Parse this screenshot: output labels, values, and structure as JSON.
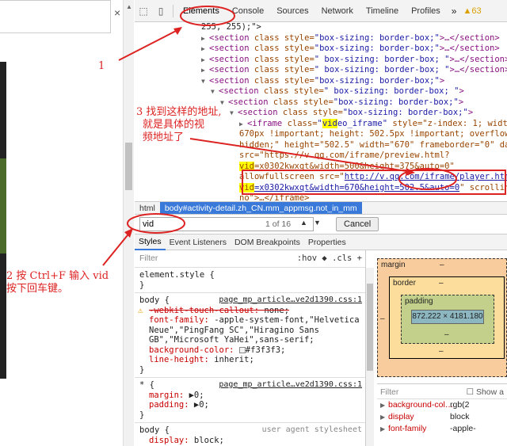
{
  "left": {
    "close_glyph": "×"
  },
  "tabs": {
    "items": [
      "Elements",
      "Console",
      "Sources",
      "Network",
      "Timeline",
      "Profiles"
    ],
    "more": "»",
    "warnings": "▲63"
  },
  "dom": {
    "lines": [
      {
        "indent": 7,
        "text": "255, 255);\">"
      },
      {
        "indent": 7,
        "tri": "▶",
        "tag": "<section",
        "attr": "class",
        "extra": " style=",
        "val": "\"box-sizing: border-box;\"",
        "tail": ">…</section>"
      },
      {
        "indent": 7,
        "tri": "▶",
        "tag": "<section",
        "attr": "class",
        "extra": " style=",
        "val": "\"box-sizing: border-box;\"",
        "tail": ">…</section>"
      },
      {
        "indent": 7,
        "tri": "▶",
        "tag": "<section",
        "attr": "class",
        "extra": " style=",
        "val": "\"   box-sizing: border-box; \"",
        "tail": ">…</section>"
      },
      {
        "indent": 7,
        "tri": "▶",
        "tag": "<section",
        "attr": "class",
        "extra": " style=",
        "val": "\"   box-sizing: border-box; \"",
        "tail": ">…</section>"
      },
      {
        "indent": 7,
        "tri": "▼",
        "tag": "<section",
        "attr": "class",
        "extra": " style=",
        "val": "\"box-sizing: border-box;\"",
        "tail": ">"
      },
      {
        "indent": 8,
        "tri": "▼",
        "tag": "<section",
        "attr": "class",
        "extra": " style=",
        "val": "\"   box-sizing: border-box; \"",
        "tail": ">"
      },
      {
        "indent": 9,
        "tri": "▼",
        "tag": "<section",
        "attr": "class",
        "extra": " style=",
        "val": "\"box-sizing: border-box;\"",
        "tail": ">"
      },
      {
        "indent": 10,
        "tri": "▼",
        "tag": "<section",
        "attr": "class",
        "extra": " style=",
        "val": "\"box-sizing: border-box;\"",
        "tail": ">"
      }
    ],
    "iframe_lines": [
      "670px !important; height: 502.5px !important; overflow:",
      "hidden;\" height=\"502.5\" width=\"670\" frameborder=\"0\" data-",
      "src=\"https://v.qq.com/iframe/preview.html?",
      "vid=x0302kwxqt&width=500&height=375&auto=0\"",
      "allowfullscreen src=\"http://v.qq.com/iframe/player.html?",
      "vid=x0302kwxqt&width=670&height=502.5&auto=0\" scrolling=\"",
      "no\">…</iframe>"
    ],
    "iframe_head_tag": "<iframe",
    "iframe_head_attr": " class=",
    "iframe_head_val_pre": "\"",
    "iframe_head_val_hl": "vid",
    "iframe_head_val_post": "eo_iframe\"",
    "iframe_head_tail": " style=\"z-index: 1; width:"
  },
  "breadcrumbs": {
    "html": "html",
    "body": "body#activity-detail.zh_CN.mm_appmsg.not_in_mm"
  },
  "search": {
    "value": "vid",
    "count": "1 of 16",
    "up": "▲",
    "down": "▼",
    "cancel": "Cancel"
  },
  "subtabs": [
    "Styles",
    "Event Listeners",
    "DOM Breakpoints",
    "Properties"
  ],
  "styles": {
    "filter": "Filter",
    "tools": ":hov  ◆  .cls  +",
    "element_style": "element.style {",
    "close": "}",
    "body_sel": "body {",
    "body_src": "page_mp_article…ve2d1390.css:1",
    "body_props": [
      {
        "p": "-webkit-touch-callout",
        "v": "none;",
        "strike": true,
        "warn": true
      },
      {
        "p": "font-family",
        "v": "-apple-system-font,\"Helvetica",
        "strike": false
      },
      {
        "p": "",
        "v": "   Neue\",\"PingFang SC\",\"Hiragino Sans",
        "strike": false
      },
      {
        "p": "",
        "v": "   GB\",\"Microsoft YaHei\",sans-serif;",
        "strike": false
      },
      {
        "p": "background-color",
        "v": "#f3f3f3;",
        "strike": false,
        "swatch": true
      },
      {
        "p": "line-height",
        "v": "inherit;",
        "strike": false
      }
    ],
    "star_sel": "* {",
    "star_src": "page_mp_article…ve2d1390.css:1",
    "star_props": [
      {
        "p": "margin",
        "v": "▶0;"
      },
      {
        "p": "padding",
        "v": "▶0;"
      }
    ],
    "ua_sel": "body {",
    "ua_src": "user agent stylesheet",
    "ua_prop": {
      "p": "display",
      "v": "block;"
    }
  },
  "boxmodel": {
    "margin": "margin",
    "border": "border",
    "padding": "padding",
    "content": "872.222 × 4181.180",
    "dash": "–"
  },
  "computed": {
    "filter": "Filter",
    "show_all": "Show a",
    "rows": [
      {
        "p": "background-col…",
        "v": "rgb(2"
      },
      {
        "p": "display",
        "v": "block"
      },
      {
        "p": "font-family",
        "v": "-apple-"
      }
    ]
  },
  "annotations": {
    "a1": "1",
    "a2_line1": "2  按 Ctrl+F 输入 vid",
    "a2_line2": "按下回车键。",
    "a3_line1": "3 找到这样的地址,",
    "a3_line2": "就是具体的视",
    "a3_line3": "频地址了"
  },
  "colors": {
    "annotation": "#dd2222",
    "selected_crumb": "#3879d9"
  }
}
